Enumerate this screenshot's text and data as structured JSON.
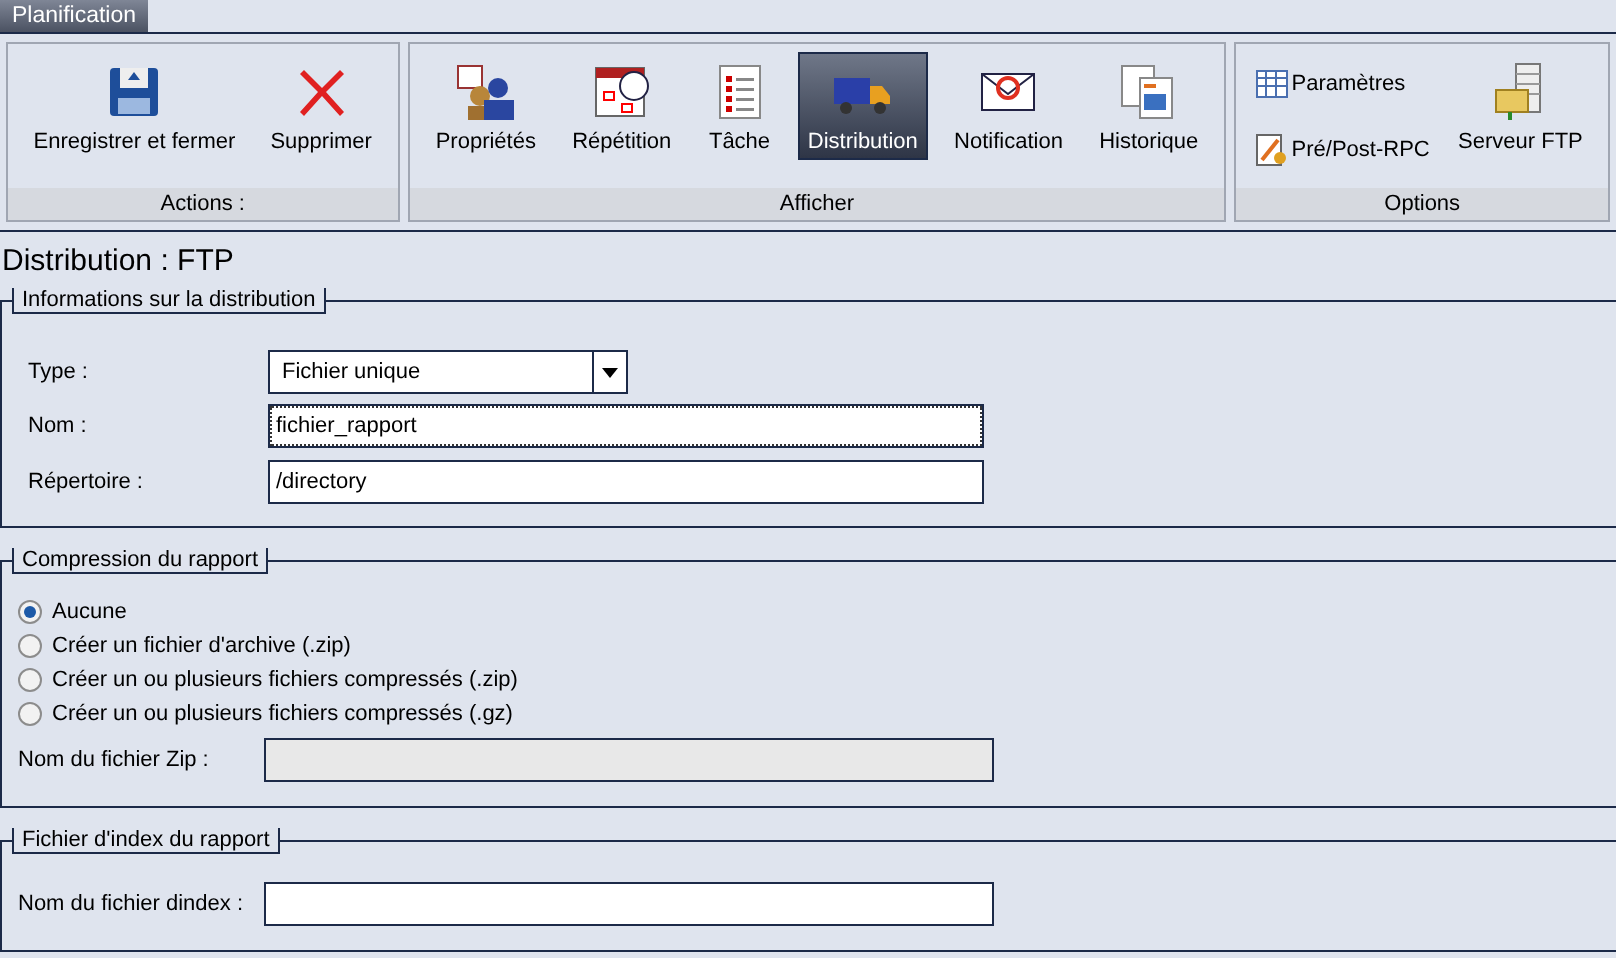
{
  "tab": {
    "label": "Planification",
    "selected": true
  },
  "ribbon": [
    {
      "label": "Actions :",
      "items": [
        {
          "label": "Enregistrer et fermer",
          "kind": "large",
          "selected": false
        },
        {
          "label": "Supprimer",
          "kind": "large",
          "selected": false
        }
      ]
    },
    {
      "label": "Afficher",
      "items": [
        {
          "label": "Propriétés",
          "kind": "large",
          "selected": false
        },
        {
          "label": "Répétition",
          "kind": "large",
          "selected": false
        },
        {
          "label": "Tâche",
          "kind": "large",
          "selected": false
        },
        {
          "label": "Distribution",
          "kind": "large",
          "selected": true
        },
        {
          "label": "Notification",
          "kind": "large",
          "selected": false
        },
        {
          "label": "Historique",
          "kind": "large",
          "selected": false
        }
      ]
    },
    {
      "label": "Options",
      "items": [
        {
          "label": "Paramètres",
          "kind": "small",
          "selected": false
        },
        {
          "label": "Pré/Post-RPC",
          "kind": "small",
          "selected": false
        },
        {
          "label": "Serveur FTP",
          "kind": "large",
          "selected": false
        }
      ]
    }
  ],
  "title": "Distribution : FTP",
  "sections": [
    {
      "legend": "Informations sur la distribution",
      "rows": [
        {
          "kind": "select",
          "label": "Type :",
          "value": "Fichier unique"
        },
        {
          "kind": "text",
          "label": "Nom :",
          "value": "fichier_rapport",
          "focused": true,
          "disabled": false
        },
        {
          "kind": "text",
          "label": "Répertoire :",
          "value": "/directory",
          "focused": false,
          "disabled": false
        }
      ]
    },
    {
      "legend": "Compression du rapport",
      "rows": [
        {
          "kind": "radio",
          "label": "Aucune",
          "selected": true
        },
        {
          "kind": "radio",
          "label": "Créer un fichier d'archive (.zip)",
          "selected": false
        },
        {
          "kind": "radio",
          "label": "Créer un ou plusieurs fichiers compressés (.zip)",
          "selected": false
        },
        {
          "kind": "radio",
          "label": "Créer un ou plusieurs fichiers compressés (.gz)",
          "selected": false
        },
        {
          "kind": "text",
          "label": "Nom du fichier Zip :",
          "focused": false,
          "disabled": true
        }
      ]
    },
    {
      "legend": "Fichier d'index du rapport",
      "rows": [
        {
          "kind": "text",
          "label": "Nom du fichier dindex :",
          "focused": false,
          "disabled": false
        }
      ]
    }
  ]
}
